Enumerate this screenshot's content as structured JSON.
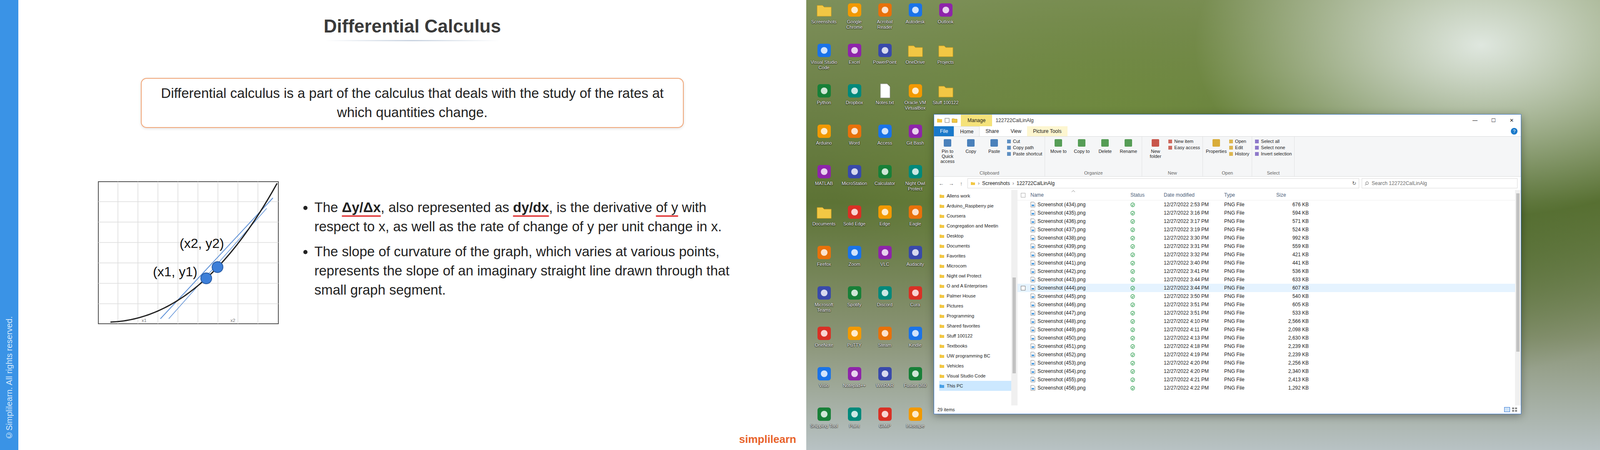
{
  "slide": {
    "title": "Differential Calculus",
    "copyright": "©Simplilearn. All rights reserved.",
    "definition": "Differential calculus is a part of the calculus that deals with the study of the rates at which quantities change.",
    "graph": {
      "point_labels": [
        "(x2, y2)",
        "(x1, y1)"
      ],
      "tick_labels": [
        "x1",
        "x2"
      ]
    },
    "bullets": [
      [
        {
          "text": "The ",
          "bold": false,
          "underlined": false
        },
        {
          "text": "Δy/Δx",
          "bold": true,
          "underlined": true
        },
        {
          "text": ", also represented as ",
          "bold": false,
          "underlined": false
        },
        {
          "text": "dy/dx",
          "bold": true,
          "underlined": true
        },
        {
          "text": ", is the derivative ",
          "bold": false,
          "underlined": false
        },
        {
          "text": "of y",
          "bold": false,
          "underlined": true
        },
        {
          "text": " with respect to x, as well as the rate of change of y per unit change in x.",
          "bold": false,
          "underlined": false
        }
      ],
      [
        {
          "text": "The slope of curvature of the graph, which varies at various points, represents the slope of an imaginary straight line drawn through that small graph segment.",
          "bold": false,
          "underlined": false
        }
      ]
    ],
    "logo": "simplilearn"
  },
  "desktop": {
    "icons": [
      {
        "label": "Screenshots",
        "kind": "folder"
      },
      {
        "label": "Visual Studio Code",
        "kind": "app"
      },
      {
        "label": "Python",
        "kind": "app"
      },
      {
        "label": "Arduino",
        "kind": "app"
      },
      {
        "label": "MATLAB",
        "kind": "app"
      },
      {
        "label": "Documents",
        "kind": "folder"
      },
      {
        "label": "Firefox",
        "kind": "app"
      },
      {
        "label": "Microsoft Teams",
        "kind": "app"
      },
      {
        "label": "OneNote",
        "kind": "app"
      },
      {
        "label": "Visio",
        "kind": "app"
      },
      {
        "label": "Snipping Tool",
        "kind": "app"
      },
      {
        "label": "Google Chrome",
        "kind": "app"
      },
      {
        "label": "Excel",
        "kind": "app"
      },
      {
        "label": "Dropbox",
        "kind": "app"
      },
      {
        "label": "Word",
        "kind": "app"
      },
      {
        "label": "MicroStation",
        "kind": "app"
      },
      {
        "label": "Solid Edge",
        "kind": "app"
      },
      {
        "label": "Zoom",
        "kind": "app"
      },
      {
        "label": "Spotify",
        "kind": "app"
      },
      {
        "label": "PuTTY",
        "kind": "app"
      },
      {
        "label": "Notepad++",
        "kind": "app"
      },
      {
        "label": "Paint",
        "kind": "app"
      },
      {
        "label": "Acrobat Reader",
        "kind": "app"
      },
      {
        "label": "PowerPoint",
        "kind": "app"
      },
      {
        "label": "Notes.txt",
        "kind": "file"
      },
      {
        "label": "Access",
        "kind": "app"
      },
      {
        "label": "Calculator",
        "kind": "app"
      },
      {
        "label": "Edge",
        "kind": "app"
      },
      {
        "label": "VLC",
        "kind": "app"
      },
      {
        "label": "Discord",
        "kind": "app"
      },
      {
        "label": "Steam",
        "kind": "app"
      },
      {
        "label": "WinRAR",
        "kind": "app"
      },
      {
        "label": "GIMP",
        "kind": "app"
      },
      {
        "label": "Autodesk",
        "kind": "app"
      },
      {
        "label": "OneDrive",
        "kind": "folder"
      },
      {
        "label": "Oracle VM VirtualBox",
        "kind": "app"
      },
      {
        "label": "Git Bash",
        "kind": "app"
      },
      {
        "label": "Night Owl Protect",
        "kind": "app"
      },
      {
        "label": "Eagle",
        "kind": "app"
      },
      {
        "label": "Audacity",
        "kind": "app"
      },
      {
        "label": "Cura",
        "kind": "app"
      },
      {
        "label": "Kindle",
        "kind": "app"
      },
      {
        "label": "Fusion 360",
        "kind": "app"
      },
      {
        "label": "Inkscape",
        "kind": "app"
      },
      {
        "label": "Outlook",
        "kind": "app"
      },
      {
        "label": "Projects",
        "kind": "folder"
      },
      {
        "label": "Stuff 100122",
        "kind": "folder"
      }
    ]
  },
  "explorer": {
    "manage_tab": "Manage",
    "title": "122722CalLinAlg",
    "controls": [
      "—",
      "☐",
      "✕"
    ],
    "tabs": [
      {
        "label": "File",
        "selected": false,
        "kind": "file"
      },
      {
        "label": "Home",
        "selected": true,
        "kind": "normal"
      },
      {
        "label": "Share",
        "selected": false,
        "kind": "normal"
      },
      {
        "label": "View",
        "selected": false,
        "kind": "normal"
      },
      {
        "label": "Picture Tools",
        "selected": false,
        "kind": "context"
      }
    ],
    "help": "?",
    "ribbon": [
      {
        "label": "Clipboard",
        "items": [
          {
            "label": "Pin to Quick access",
            "kind": "large"
          },
          {
            "label": "Copy",
            "kind": "large"
          },
          {
            "label": "Paste",
            "kind": "large"
          },
          {
            "label": "Cut",
            "kind": "small"
          },
          {
            "label": "Copy path",
            "kind": "small"
          },
          {
            "label": "Paste shortcut",
            "kind": "small"
          }
        ]
      },
      {
        "label": "Organize",
        "items": [
          {
            "label": "Move to",
            "kind": "large"
          },
          {
            "label": "Copy to",
            "kind": "large"
          },
          {
            "label": "Delete",
            "kind": "large"
          },
          {
            "label": "Rename",
            "kind": "large"
          }
        ]
      },
      {
        "label": "New",
        "items": [
          {
            "label": "New folder",
            "kind": "large"
          },
          {
            "label": "New item",
            "kind": "small"
          },
          {
            "label": "Easy access",
            "kind": "small"
          }
        ]
      },
      {
        "label": "Open",
        "items": [
          {
            "label": "Properties",
            "kind": "large"
          },
          {
            "label": "Open",
            "kind": "small"
          },
          {
            "label": "Edit",
            "kind": "small"
          },
          {
            "label": "History",
            "kind": "small"
          }
        ]
      },
      {
        "label": "Select",
        "items": [
          {
            "label": "Select all",
            "kind": "small"
          },
          {
            "label": "Select none",
            "kind": "small"
          },
          {
            "label": "Invert selection",
            "kind": "small"
          }
        ]
      }
    ],
    "nav_buttons": [
      "←",
      "→",
      "↑"
    ],
    "path": [
      "Screenshots",
      "122722CalLinAlg"
    ],
    "path_separator": "›",
    "refresh": "↻",
    "search_placeholder": "Search 122722CalLinAlg",
    "nav": [
      {
        "label": "Allens work",
        "selected": false
      },
      {
        "label": "Arduino_Raspberry pie",
        "selected": false
      },
      {
        "label": "Coursera",
        "selected": false
      },
      {
        "label": "Congregation and Meetin",
        "selected": false
      },
      {
        "label": "Desktop",
        "selected": false
      },
      {
        "label": "Documents",
        "selected": false
      },
      {
        "label": "Favorites",
        "selected": false
      },
      {
        "label": "Microcom",
        "selected": false
      },
      {
        "label": "Night owl Protect",
        "selected": false
      },
      {
        "label": "O and A Enterprises",
        "selected": false
      },
      {
        "label": "Palmer House",
        "selected": false
      },
      {
        "label": "Pictures",
        "selected": false
      },
      {
        "label": "Programming",
        "selected": false
      },
      {
        "label": "Shared favorites",
        "selected": false
      },
      {
        "label": "Stuff 100122",
        "selected": false
      },
      {
        "label": "Textbooks",
        "selected": false
      },
      {
        "label": "UW programming BC",
        "selected": false
      },
      {
        "label": "Vehicles",
        "selected": false
      },
      {
        "label": "Visual Studio Code",
        "selected": false
      },
      {
        "label": "This PC",
        "selected": true
      }
    ],
    "columns": [
      "Name",
      "Status",
      "Date modified",
      "Type",
      "Size"
    ],
    "rows": [
      {
        "name": "Screenshot (434).png",
        "date": "12/27/2022 2:53 PM",
        "type": "PNG File",
        "size": "676 KB",
        "hovered": false
      },
      {
        "name": "Screenshot (435).png",
        "date": "12/27/2022 3:16 PM",
        "type": "PNG File",
        "size": "594 KB",
        "hovered": false
      },
      {
        "name": "Screenshot (436).png",
        "date": "12/27/2022 3:17 PM",
        "type": "PNG File",
        "size": "571 KB",
        "hovered": false
      },
      {
        "name": "Screenshot (437).png",
        "date": "12/27/2022 3:19 PM",
        "type": "PNG File",
        "size": "524 KB",
        "hovered": false
      },
      {
        "name": "Screenshot (438).png",
        "date": "12/27/2022 3:30 PM",
        "type": "PNG File",
        "size": "992 KB",
        "hovered": false
      },
      {
        "name": "Screenshot (439).png",
        "date": "12/27/2022 3:31 PM",
        "type": "PNG File",
        "size": "559 KB",
        "hovered": false
      },
      {
        "name": "Screenshot (440).png",
        "date": "12/27/2022 3:32 PM",
        "type": "PNG File",
        "size": "421 KB",
        "hovered": false
      },
      {
        "name": "Screenshot (441).png",
        "date": "12/27/2022 3:40 PM",
        "type": "PNG File",
        "size": "441 KB",
        "hovered": false
      },
      {
        "name": "Screenshot (442).png",
        "date": "12/27/2022 3:41 PM",
        "type": "PNG File",
        "size": "536 KB",
        "hovered": false
      },
      {
        "name": "Screenshot (443).png",
        "date": "12/27/2022 3:44 PM",
        "type": "PNG File",
        "size": "633 KB",
        "hovered": false
      },
      {
        "name": "Screenshot (444).png",
        "date": "12/27/2022 3:44 PM",
        "type": "PNG File",
        "size": "607 KB",
        "hovered": true
      },
      {
        "name": "Screenshot (445).png",
        "date": "12/27/2022 3:50 PM",
        "type": "PNG File",
        "size": "540 KB",
        "hovered": false
      },
      {
        "name": "Screenshot (446).png",
        "date": "12/27/2022 3:51 PM",
        "type": "PNG File",
        "size": "605 KB",
        "hovered": false
      },
      {
        "name": "Screenshot (447).png",
        "date": "12/27/2022 3:51 PM",
        "type": "PNG File",
        "size": "533 KB",
        "hovered": false
      },
      {
        "name": "Screenshot (448).png",
        "date": "12/27/2022 4:10 PM",
        "type": "PNG File",
        "size": "2,566 KB",
        "hovered": false
      },
      {
        "name": "Screenshot (449).png",
        "date": "12/27/2022 4:11 PM",
        "type": "PNG File",
        "size": "2,098 KB",
        "hovered": false
      },
      {
        "name": "Screenshot (450).png",
        "date": "12/27/2022 4:13 PM",
        "type": "PNG File",
        "size": "2,630 KB",
        "hovered": false
      },
      {
        "name": "Screenshot (451).png",
        "date": "12/27/2022 4:18 PM",
        "type": "PNG File",
        "size": "2,239 KB",
        "hovered": false
      },
      {
        "name": "Screenshot (452).png",
        "date": "12/27/2022 4:19 PM",
        "type": "PNG File",
        "size": "2,239 KB",
        "hovered": false
      },
      {
        "name": "Screenshot (453).png",
        "date": "12/27/2022 4:20 PM",
        "type": "PNG File",
        "size": "2,256 KB",
        "hovered": false
      },
      {
        "name": "Screenshot (454).png",
        "date": "12/27/2022 4:20 PM",
        "type": "PNG File",
        "size": "2,340 KB",
        "hovered": false
      },
      {
        "name": "Screenshot (455).png",
        "date": "12/27/2022 4:21 PM",
        "type": "PNG File",
        "size": "2,413 KB",
        "hovered": false
      },
      {
        "name": "Screenshot (456).png",
        "date": "12/27/2022 4:22 PM",
        "type": "PNG File",
        "size": "1,292 KB",
        "hovered": false
      }
    ],
    "status": "29 items"
  }
}
